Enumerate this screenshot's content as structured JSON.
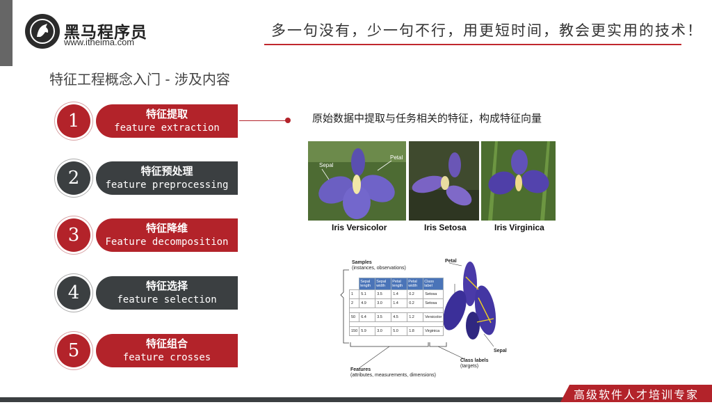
{
  "header": {
    "brand_name": "黑马程序员",
    "brand_url": "www.itheima.com",
    "slogan": "多一句没有，少一句不行，用更短时间，教会更实用的技术！"
  },
  "slide": {
    "title": "特征工程概念入门  -  涉及内容",
    "steps": [
      {
        "num": "1",
        "zh": "特征提取",
        "en": "feature extraction"
      },
      {
        "num": "2",
        "zh": "特征预处理",
        "en": "feature preprocessing"
      },
      {
        "num": "3",
        "zh": "特征降维",
        "en": "Feature decomposition"
      },
      {
        "num": "4",
        "zh": "特征选择",
        "en": "feature selection"
      },
      {
        "num": "5",
        "zh": "特征组合",
        "en": "feature crosses"
      }
    ],
    "description": "原始数据中提取与任务相关的特征，构成特征向量"
  },
  "photos": {
    "captions": [
      "Iris Versicolor",
      "Iris Setosa",
      "Iris Virginica"
    ],
    "labels": {
      "sepal": "Sepal",
      "petal": "Petal"
    }
  },
  "diagram": {
    "samples_label": "Samples",
    "samples_sub": "(instances, observations)",
    "petal_label": "Petal",
    "sepal_label": "Sepal",
    "class_labels": "Class labels",
    "class_labels_sub": "(targets)",
    "features_label": "Features",
    "features_sub": "(attributes, measurements, dimensions)",
    "headers": [
      "",
      "Sepal length",
      "Sepal width",
      "Petal length",
      "Petal width",
      "Class label"
    ],
    "rows": [
      [
        "1",
        "5.1",
        "3.5",
        "1.4",
        "0.2",
        "Setosa"
      ],
      [
        "2",
        "4.9",
        "3.0",
        "1.4",
        "0.2",
        "Setosa"
      ],
      [
        "50",
        "6.4",
        "3.5",
        "4.5",
        "1.2",
        "Versicolor"
      ],
      [
        "150",
        "5.9",
        "3.0",
        "5.0",
        "1.8",
        "Virginica"
      ]
    ]
  },
  "footer": {
    "tag": "高级软件人才培训专家"
  },
  "colors": {
    "accent": "#b3232a",
    "dark": "#3b3f41"
  }
}
